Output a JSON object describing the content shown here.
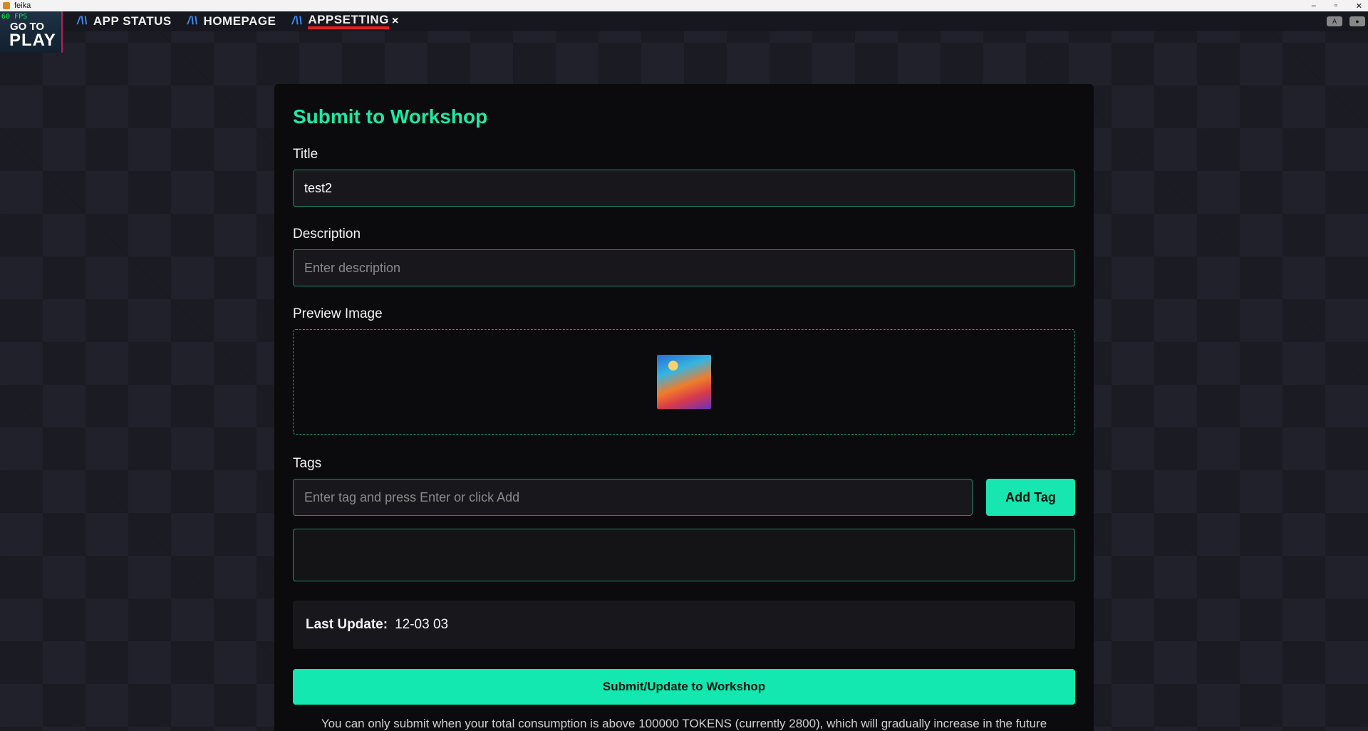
{
  "window": {
    "title": "feika",
    "controls": [
      "–",
      "▫",
      "✕"
    ]
  },
  "logo": {
    "fps": "60 FPS",
    "line1": "GO TO",
    "line2": "PLAY"
  },
  "nav": {
    "tabs": [
      {
        "label": "APP STATUS"
      },
      {
        "label": "HOMEPAGE"
      },
      {
        "label": "APPSETTING",
        "active": true,
        "close": "×"
      }
    ],
    "icon": "brand-a-icon"
  },
  "tray": {
    "icons": [
      "keyboard-icon",
      "discord-icon"
    ]
  },
  "form": {
    "heading": "Submit to Workshop",
    "title_label": "Title",
    "title_value": "test2",
    "description_label": "Description",
    "description_placeholder": "Enter description",
    "preview_label": "Preview Image",
    "tags_label": "Tags",
    "tags_placeholder": "Enter tag and press Enter or click Add",
    "add_tag_label": "Add Tag",
    "last_update_key": "Last Update:",
    "last_update_value": "12-03 03",
    "submit_label": "Submit/Update to Workshop",
    "note": "You can only submit when your total consumption is above 100000 TOKENS (currently 2800), which will gradually increase in the future"
  },
  "colors": {
    "accent": "#18e6b0",
    "heading": "#1de9a8",
    "border": "#1f8a6a",
    "active_underline": "#e02020"
  }
}
